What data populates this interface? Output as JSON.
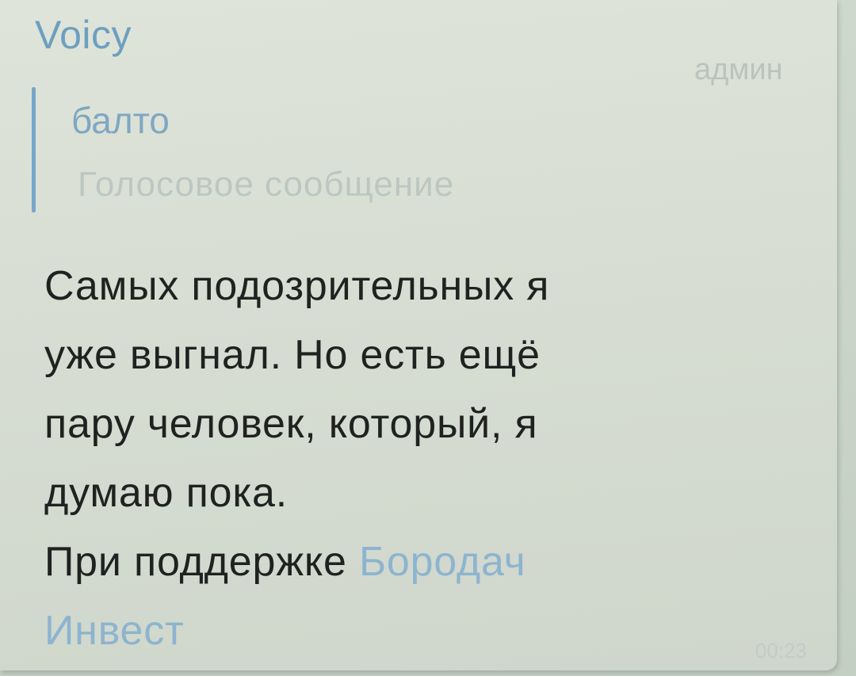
{
  "message": {
    "sender": "Voicy",
    "role": "админ",
    "reply": {
      "author": "балто",
      "text": "Голосовое сообщение"
    },
    "body_lines": [
      "Самых подозрительных я",
      "уже выгнал. Но есть ещё",
      "пару человек, который, я",
      "думаю пока."
    ],
    "footer_prefix": "При поддержке",
    "footer_link_part1": "Бородач",
    "footer_link_part2": "Инвест",
    "time": "00:23"
  },
  "colors": {
    "sender": "#6d9fbf",
    "reply_bar": "#76a7c9",
    "link": "#8db4cf",
    "text": "#1f2220",
    "bubble": "#dfe4da"
  }
}
